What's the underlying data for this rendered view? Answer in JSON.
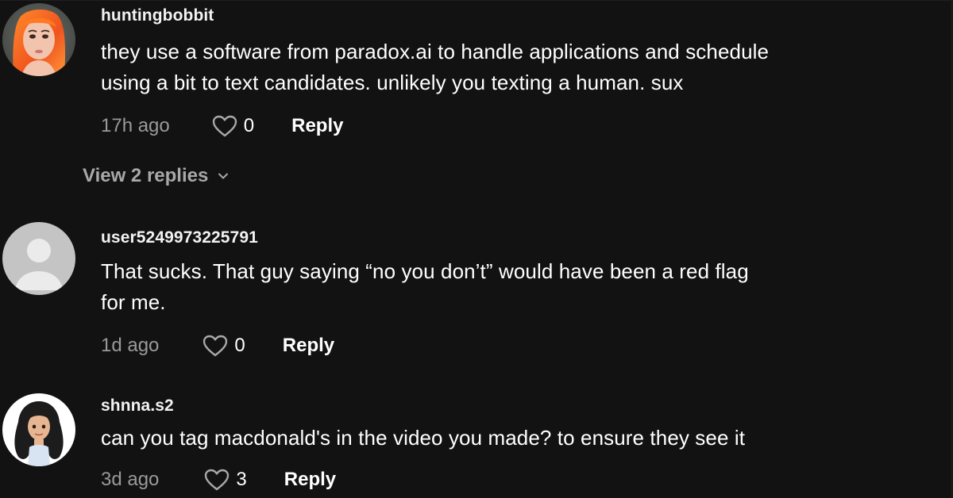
{
  "comments": [
    {
      "username": "huntingbobbit",
      "avatar": "profile-photo-orange-hair",
      "text_lines": [
        "they use a software from paradox.ai to handle applications and schedule",
        "using a bit to text candidates. unlikely you texting a human. sux"
      ],
      "timestamp": "17h ago",
      "likes": "0",
      "reply_label": "Reply",
      "view_replies_label": "View 2 replies"
    },
    {
      "username": "user5249973225791",
      "avatar": "default-avatar",
      "text_lines": [
        "That sucks. That guy saying “no you don’t” would have been a red flag",
        "for me."
      ],
      "timestamp": "1d ago",
      "likes": "0",
      "reply_label": "Reply"
    },
    {
      "username": "shnna.s2",
      "avatar": "cartoon-avatar-dark-hair",
      "text_lines": [
        "can you tag macdonald's in the video you made? to ensure they see it"
      ],
      "timestamp": "3d ago",
      "likes": "3",
      "reply_label": "Reply"
    }
  ],
  "icons": {
    "like": "heart-outline-icon",
    "expand": "chevron-down-icon"
  },
  "colors": {
    "background": "#121212",
    "primary_text": "#ffffff",
    "secondary_text": "#9a9a9a",
    "view_replies_text": "#a8a8a8",
    "default_avatar_bg": "#c4c4c4",
    "default_avatar_fg": "#ebebeb"
  }
}
